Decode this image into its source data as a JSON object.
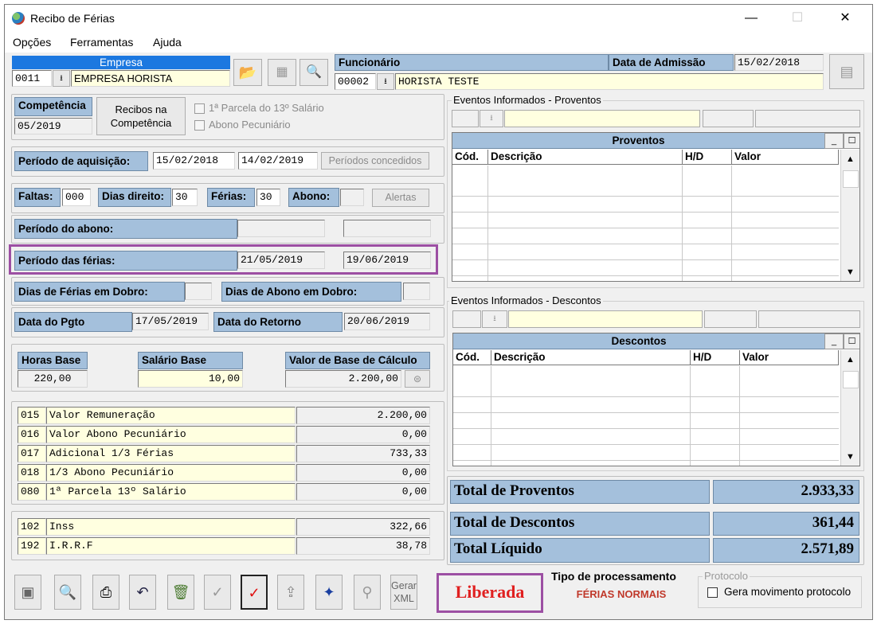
{
  "window": {
    "title": "Recibo de Férias"
  },
  "menu": [
    "Opções",
    "Ferramentas",
    "Ajuda"
  ],
  "empresa": {
    "label": "Empresa",
    "code": "0011",
    "name": "EMPRESA HORISTA"
  },
  "funcionario": {
    "label": "Funcionário",
    "code": "00002",
    "name": "HORISTA TESTE"
  },
  "admissao": {
    "label": "Data de Admissão",
    "value": "15/02/2018"
  },
  "competencia": {
    "label": "Competência",
    "value": "05/2019",
    "recibos_button": "Recibos na\nCompetência",
    "parcela13": "1ª Parcela do 13º Salário",
    "abono_pecuniario": "Abono Pecuniário"
  },
  "aquisicao": {
    "label": "Período de aquisição:",
    "start": "15/02/2018",
    "end": "14/02/2019",
    "button": "Períodos concedidos"
  },
  "faltas": {
    "label": "Faltas:",
    "value": "000",
    "dias_label": "Dias direito:",
    "dias_value": "30",
    "ferias_label": "Férias:",
    "ferias_value": "30",
    "abono_label": "Abono:",
    "alertas_button": "Alertas"
  },
  "periodo_abono": {
    "label": "Período do abono:"
  },
  "periodo_ferias": {
    "label": "Período das férias:",
    "start": "21/05/2019",
    "end": "19/06/2019"
  },
  "dobro": {
    "ferias_label": "Dias de Férias em Dobro:",
    "abono_label": "Dias de Abono em Dobro:"
  },
  "pgto": {
    "label": "Data do Pgto",
    "value": "17/05/2019",
    "retorno_label": "Data do Retorno",
    "retorno_value": "20/06/2019"
  },
  "base": {
    "horas_label": "Horas Base",
    "horas_value": "220,00",
    "salario_label": "Salário Base",
    "salario_value": "10,00",
    "calc_label": "Valor de Base de Cálculo",
    "calc_value": "2.200,00"
  },
  "proventos_items": [
    {
      "code": "015",
      "desc": "Valor Remuneração",
      "value": "2.200,00"
    },
    {
      "code": "016",
      "desc": "Valor Abono Pecuniário",
      "value": "0,00"
    },
    {
      "code": "017",
      "desc": "Adicional 1/3 Férias",
      "value": "733,33"
    },
    {
      "code": "018",
      "desc": "1/3 Abono Pecuniário",
      "value": "0,00"
    },
    {
      "code": "080",
      "desc": "1ª Parcela 13º Salário",
      "value": "0,00"
    }
  ],
  "descontos_items": [
    {
      "code": "102",
      "desc": "Inss",
      "value": "322,66"
    },
    {
      "code": "192",
      "desc": "I.R.R.F",
      "value": "38,78"
    }
  ],
  "eventos_proventos": {
    "group": "Eventos Informados - Proventos",
    "title": "Proventos",
    "cols": [
      "Cód.",
      "Descrição",
      "H/D",
      "Valor"
    ]
  },
  "eventos_descontos": {
    "group": "Eventos Informados - Descontos",
    "title": "Descontos",
    "cols": [
      "Cód.",
      "Descrição",
      "H/D",
      "Valor"
    ]
  },
  "totais": {
    "proventos_label": "Total de Proventos",
    "proventos_value": "2.933,33",
    "descontos_label": "Total de Descontos",
    "descontos_value": "361,44",
    "liquido_label": "Total Líquido",
    "liquido_value": "2.571,89"
  },
  "toolbar": {
    "gerar_xml": "Gerar\nXML"
  },
  "status": {
    "value": "Liberada",
    "color": "#e02020"
  },
  "processamento": {
    "label": "Tipo de processamento",
    "value": "FÉRIAS NORMAIS",
    "value_color": "#c0392b"
  },
  "protocolo": {
    "group": "Protocolo",
    "checkbox_label": "Gera movimento protocolo"
  }
}
